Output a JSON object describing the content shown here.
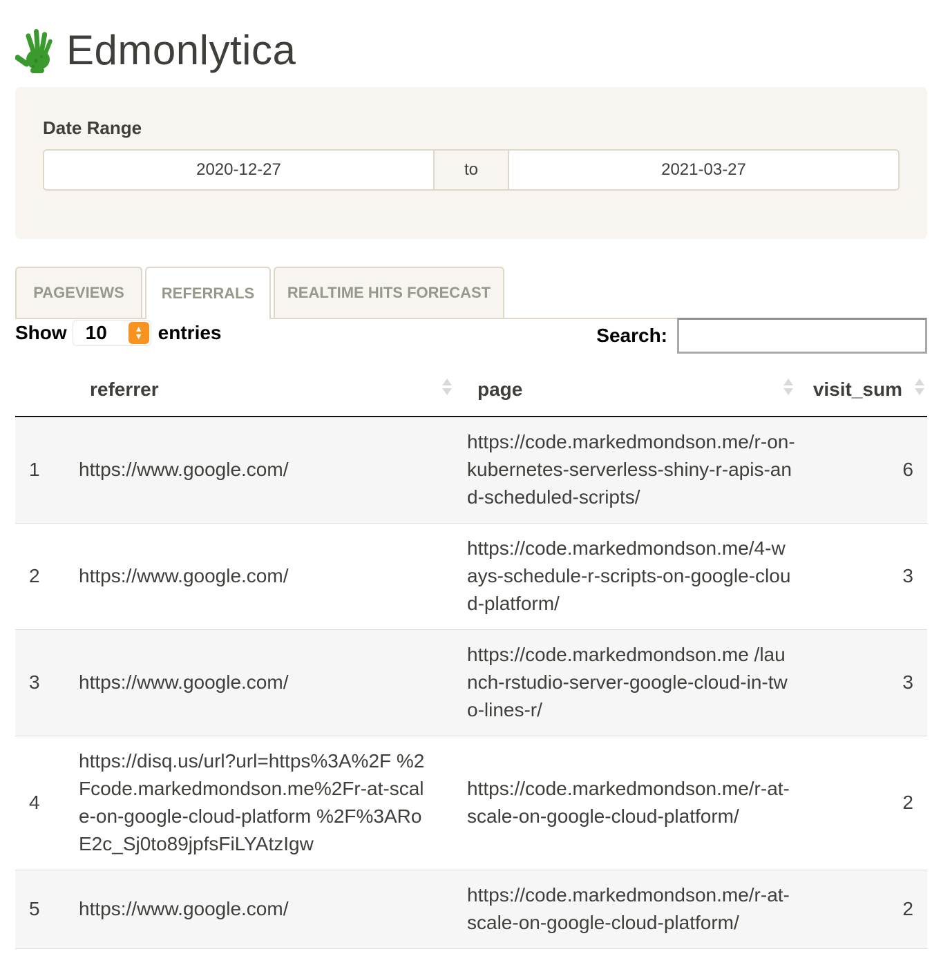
{
  "app": {
    "title": "Edmonlytica",
    "logo_icon": "green-handprint-icon"
  },
  "filters": {
    "date_range": {
      "label": "Date Range",
      "start": "2020-12-27",
      "separator": "to",
      "end": "2021-03-27"
    }
  },
  "tabs": [
    {
      "label": "PAGEVIEWS",
      "active": false
    },
    {
      "label": "REFERRALS",
      "active": true
    },
    {
      "label": "REALTIME HITS FORECAST",
      "active": false
    }
  ],
  "table_controls": {
    "show_label": "Show",
    "page_length": "10",
    "entries_label": "entries",
    "search_label": "Search:",
    "search_value": ""
  },
  "table": {
    "columns": [
      "",
      "referrer",
      "page",
      "visit_sum"
    ],
    "rows": [
      {
        "index": "1",
        "referrer": "https://www.google.com/",
        "page": "https://code.markedmondson.me/r-on-kubernetes-serverless-shiny-r-apis-and-scheduled-scripts/",
        "visit_sum": "6"
      },
      {
        "index": "2",
        "referrer": "https://www.google.com/",
        "page": "https://code.markedmondson.me/4-ways-schedule-r-scripts-on-google-cloud-platform/",
        "visit_sum": "3"
      },
      {
        "index": "3",
        "referrer": "https://www.google.com/",
        "page": "https://code.markedmondson.me /launch-rstudio-server-google-cloud-in-two-lines-r/",
        "visit_sum": "3"
      },
      {
        "index": "4",
        "referrer": "https://disq.us/url?url=https%3A%2F %2Fcode.markedmondson.me%2Fr-at-scale-on-google-cloud-platform %2F%3ARoE2c_Sj0to89jpfsFiLYAtzIgw",
        "page": "https://code.markedmondson.me/r-at-scale-on-google-cloud-platform/",
        "visit_sum": "2"
      },
      {
        "index": "5",
        "referrer": "https://www.google.com/",
        "page": "https://code.markedmondson.me/r-at-scale-on-google-cloud-platform/",
        "visit_sum": "2"
      }
    ]
  }
}
